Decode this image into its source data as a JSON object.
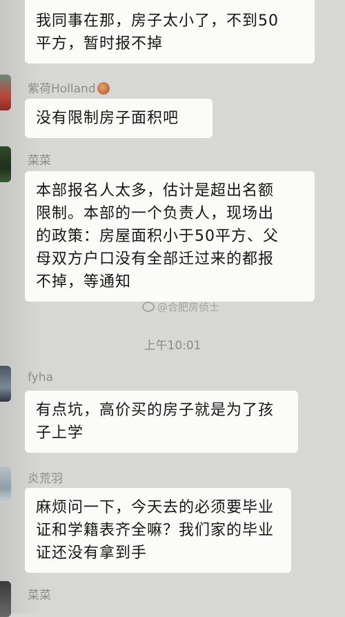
{
  "messages": [
    {
      "sender": "",
      "lines": [
        "我同事在那，房子太小了，不到50",
        "平方，暂时报不掉"
      ]
    },
    {
      "sender": "紫荷Holland",
      "lines": [
        "没有限制房子面积吧"
      ]
    },
    {
      "sender": "菜菜",
      "lines": [
        "本部报名人太多，估计是超出名额",
        "限制。本部的一个负责人，现场出",
        "的政策：房屋面积小于50平方、父",
        "母双方户口没有全部迁过来的都报",
        "不掉，等通知"
      ]
    },
    {
      "sender": "fyha",
      "lines": [
        "有点坑，高价买的房子就是为了孩",
        "子上学"
      ]
    },
    {
      "sender": "炎荒羽",
      "lines": [
        "麻烦问一下，今天去的必须要毕业",
        "证和学籍表齐全嘛？我们家的毕业",
        "证还没有拿到手"
      ]
    },
    {
      "sender": "菜菜",
      "lines": []
    }
  ],
  "timestamp": "上午10:01",
  "watermark": "@合肥房侦士"
}
